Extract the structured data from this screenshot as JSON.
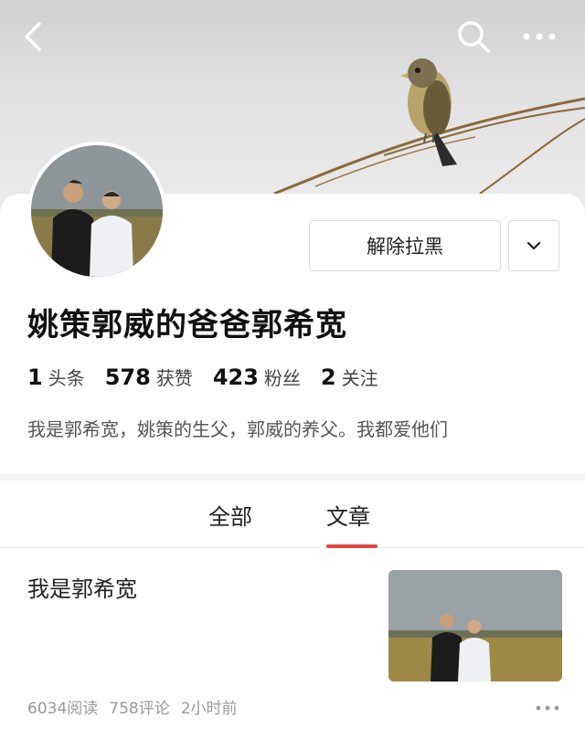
{
  "header": {
    "back_icon": "back-arrow-icon",
    "search_icon": "search-icon",
    "more_icon": "more-dots-icon"
  },
  "profile": {
    "name": "姚策郭威的爸爸郭希宽",
    "action_button_label": "解除拉黑",
    "dropdown_icon": "chevron-down-icon",
    "stats": [
      {
        "value": "1",
        "label": "头条"
      },
      {
        "value": "578",
        "label": "获赞"
      },
      {
        "value": "423",
        "label": "粉丝"
      },
      {
        "value": "2",
        "label": "关注"
      }
    ],
    "bio": "我是郭希宽，姚策的生父，郭威的养父。我都爱他们"
  },
  "tabs": {
    "items": [
      {
        "label": "全部",
        "active": false
      },
      {
        "label": "文章",
        "active": true
      }
    ],
    "active_color": "#e0463a"
  },
  "articles": [
    {
      "title": "我是郭希宽",
      "reads": "6034阅读",
      "comments": "758评论",
      "time": "2小时前"
    }
  ]
}
